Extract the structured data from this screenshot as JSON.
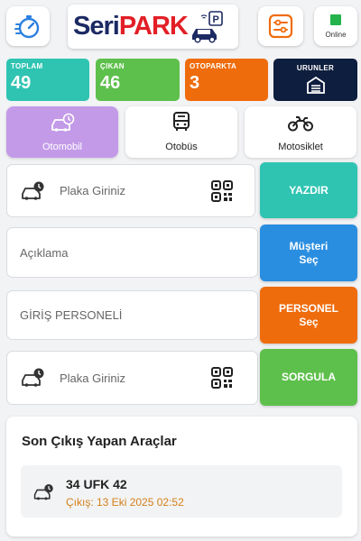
{
  "header": {
    "logo_seri": "Seri",
    "logo_park": "PARK",
    "online_label": "Online"
  },
  "stats": [
    {
      "label": "TOPLAM",
      "value": "49",
      "color": "#2fc4b2"
    },
    {
      "label": "ÇIKAN",
      "value": "46",
      "color": "#5ec04c"
    },
    {
      "label": "OTOPARKTA",
      "value": "3",
      "color": "#ef6c0c"
    },
    {
      "label": "URUNLER",
      "value": "",
      "color": "#0e1e3e"
    }
  ],
  "vehicle_types": [
    {
      "label": "Otomobil",
      "icon": "car-clock-icon",
      "selected": true
    },
    {
      "label": "Otobüs",
      "icon": "bus-icon",
      "selected": false
    },
    {
      "label": "Motosiklet",
      "icon": "motorcycle-icon",
      "selected": false
    }
  ],
  "form": {
    "plate_placeholder_1": "Plaka Giriniz",
    "description_placeholder": "Açıklama",
    "staff_placeholder": "GİRİŞ PERSONELİ",
    "plate_placeholder_2": "Plaka Giriniz",
    "print_label": "YAZDIR",
    "customer_label_1": "Müşteri",
    "customer_label_2": "Seç",
    "staff_label_1": "PERSONEL",
    "staff_label_2": "Seç",
    "query_label": "SORGULA"
  },
  "colors": {
    "teal": "#2fc4b2",
    "blue": "#2a8ee0",
    "orange": "#ef6c0c",
    "green": "#5ec04c",
    "purple": "#c39ae8",
    "online": "#24b24b"
  },
  "recent_exits": {
    "title": "Son Çıkış Yapan Araçlar",
    "items": [
      {
        "plate": "34 UFK 42",
        "time": "Çıkış: 13 Eki 2025 02:52"
      }
    ]
  }
}
